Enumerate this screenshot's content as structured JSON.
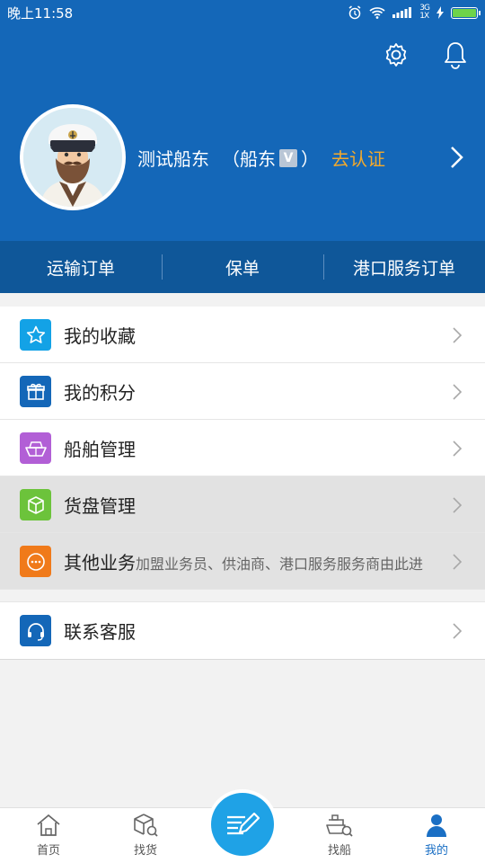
{
  "status_bar": {
    "time": "晚上11:58",
    "network": "3G",
    "network_sub": "1X"
  },
  "profile": {
    "name": "测试船东",
    "role_open": "（船东",
    "role_badge": "V",
    "role_close": "）",
    "verify": "去认证"
  },
  "tabs": [
    {
      "label": "运输订单"
    },
    {
      "label": "保单"
    },
    {
      "label": "港口服务订单"
    }
  ],
  "menu": [
    {
      "label": "我的收藏",
      "icon": "star-icon",
      "color": "#13a2e6"
    },
    {
      "label": "我的积分",
      "icon": "gift-icon",
      "color": "#1467b8"
    },
    {
      "label": "船舶管理",
      "icon": "ship-icon",
      "color": "#b25fd6"
    },
    {
      "label": "货盘管理",
      "icon": "box-icon",
      "color": "#6cc33b"
    },
    {
      "label": "其他业务",
      "sub": "加盟业务员、供油商、港口服务服务商由此进",
      "icon": "more-icon",
      "color": "#f07a1a"
    }
  ],
  "menu2": [
    {
      "label": "联系客服",
      "icon": "headset-icon",
      "color": "#1467b8"
    }
  ],
  "bottom_nav": [
    {
      "label": "首页",
      "icon": "home-icon"
    },
    {
      "label": "找货",
      "icon": "find-cargo-icon"
    },
    {
      "label": "找船",
      "icon": "find-ship-icon"
    },
    {
      "label": "我的",
      "icon": "profile-icon",
      "active": true
    }
  ],
  "colors": {
    "header": "#1467b8",
    "tabs": "#0f5799",
    "accent": "#f3a92c",
    "active_nav": "#1a6fc4",
    "fab": "#1fa2e6"
  }
}
